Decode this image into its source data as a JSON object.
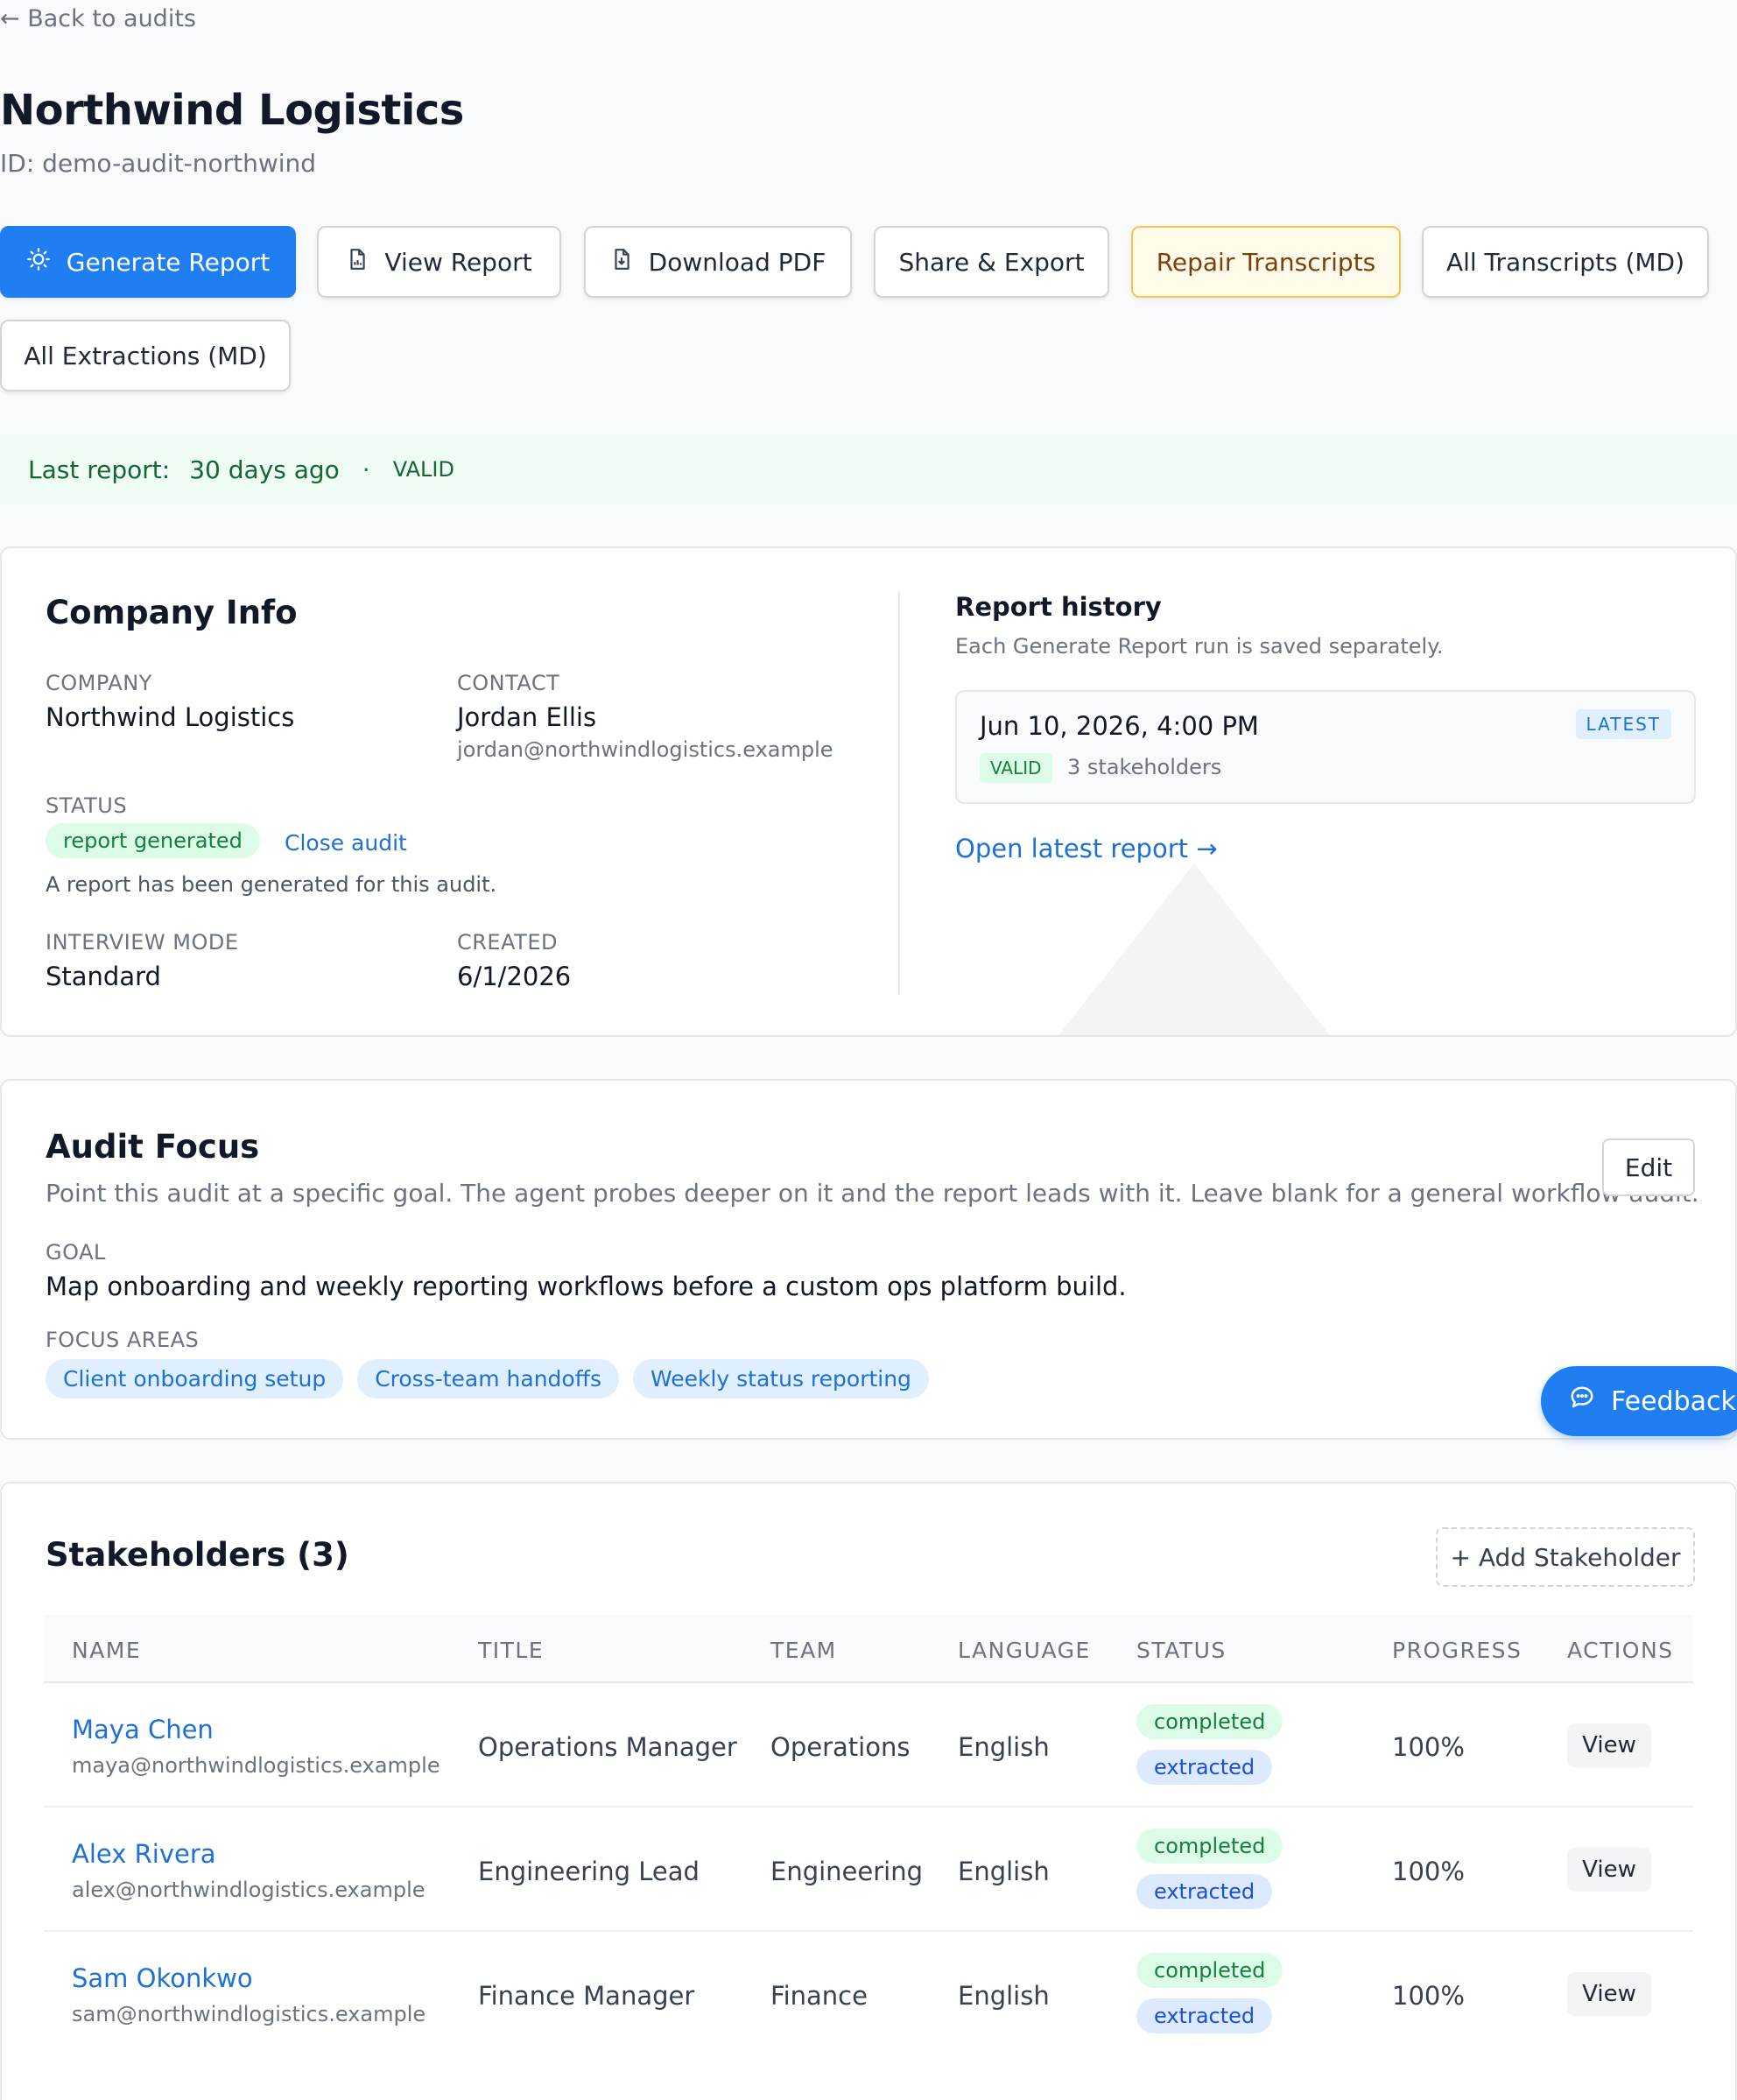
{
  "nav": {
    "back_label": "← Back to audits"
  },
  "header": {
    "title": "Northwind Logistics",
    "id_text": "ID: demo-audit-northwind"
  },
  "toolbar": {
    "generate_report": "Generate Report",
    "view_report": "View Report",
    "download_pdf": "Download PDF",
    "share_export": "Share & Export",
    "repair_transcripts": "Repair Transcripts",
    "all_transcripts": "All Transcripts (MD)",
    "all_extractions": "All Extractions (MD)"
  },
  "banner": {
    "label": "Last report:",
    "age": "30 days ago",
    "separator": "·",
    "status": "VALID"
  },
  "company_info": {
    "title": "Company Info",
    "company_label": "COMPANY",
    "company_value": "Northwind Logistics",
    "contact_label": "CONTACT",
    "contact_name": "Jordan Ellis",
    "contact_email": "jordan@northwindlogistics.example",
    "status_label": "STATUS",
    "status_value": "report generated",
    "close_audit": "Close audit",
    "status_note": "A report has been generated for this audit.",
    "mode_label": "INTERVIEW MODE",
    "mode_value": "Standard",
    "created_label": "CREATED",
    "created_value": "6/1/2026"
  },
  "report_history": {
    "title": "Report history",
    "subtitle": "Each Generate Report run is saved separately.",
    "entry_date": "Jun 10, 2026, 4:00 PM",
    "entry_badge": "LATEST",
    "entry_status": "VALID",
    "entry_stakeholders": "3 stakeholders",
    "open_latest": "Open latest report →"
  },
  "audit_focus": {
    "title": "Audit Focus",
    "description": "Point this audit at a specific goal. The agent probes deeper on it and the report leads with it. Leave blank for a general workflow audit.",
    "edit_label": "Edit",
    "goal_label": "GOAL",
    "goal_value": "Map onboarding and weekly reporting workflows before a custom ops platform build.",
    "focus_label": "FOCUS AREAS",
    "focus_areas": [
      "Client onboarding setup",
      "Cross-team handoffs",
      "Weekly status reporting"
    ]
  },
  "stakeholders": {
    "title": "Stakeholders (3)",
    "add_label": "+ Add Stakeholder",
    "columns": [
      "NAME",
      "TITLE",
      "TEAM",
      "LANGUAGE",
      "STATUS",
      "PROGRESS",
      "ACTIONS"
    ],
    "rows": [
      {
        "name": "Maya Chen",
        "email": "maya@northwindlogistics.example",
        "title": "Operations Manager",
        "team": "Operations",
        "language": "English",
        "status1": "completed",
        "status2": "extracted",
        "progress": "100%",
        "action": "View"
      },
      {
        "name": "Alex Rivera",
        "email": "alex@northwindlogistics.example",
        "title": "Engineering Lead",
        "team": "Engineering",
        "language": "English",
        "status1": "completed",
        "status2": "extracted",
        "progress": "100%",
        "action": "View"
      },
      {
        "name": "Sam Okonkwo",
        "email": "sam@northwindlogistics.example",
        "title": "Finance Manager",
        "team": "Finance",
        "language": "English",
        "status1": "completed",
        "status2": "extracted",
        "progress": "100%",
        "action": "View"
      }
    ]
  },
  "feedback": {
    "label": "Feedback"
  },
  "colors": {
    "primary": "#1f7ff2",
    "valid_green": "#15803d",
    "link_blue": "#1d70d6",
    "warn_border": "#f5c451"
  }
}
